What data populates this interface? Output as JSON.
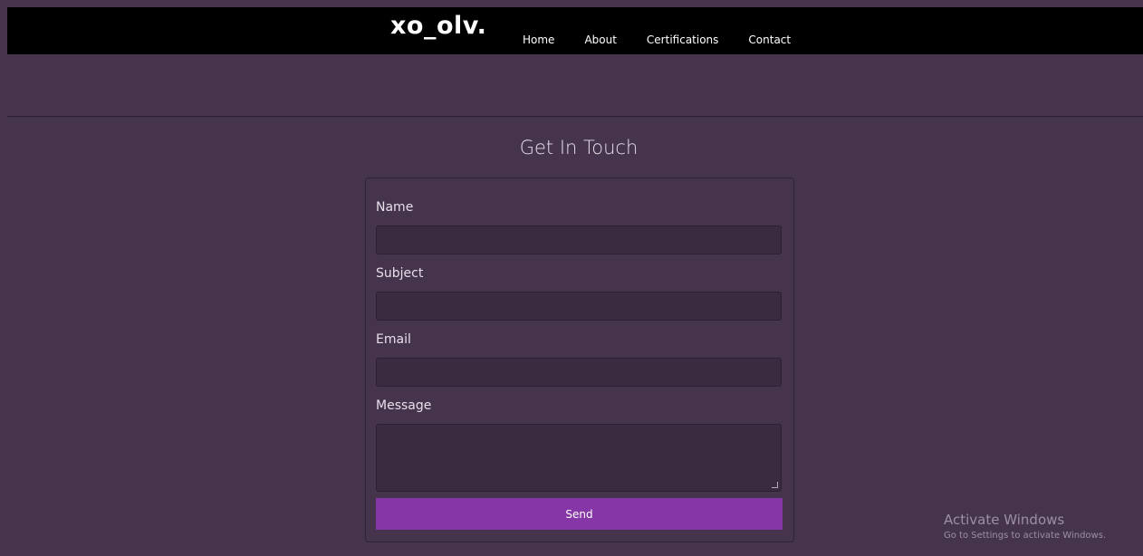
{
  "nav": {
    "brand": "xo_olv.",
    "links": [
      "Home",
      "About",
      "Certifications",
      "Contact"
    ]
  },
  "contact": {
    "title": "Get In Touch",
    "fields": {
      "name_label": "Name",
      "name_value": "",
      "subject_label": "Subject",
      "subject_value": "",
      "email_label": "Email",
      "email_value": "",
      "message_label": "Message",
      "message_value": ""
    },
    "send_label": "Send"
  },
  "watermark": {
    "title": "Activate Windows",
    "subtitle": "Go to Settings to activate Windows."
  },
  "colors": {
    "background": "#46344d",
    "navbar": "#000000",
    "input_bg": "#3a2b40",
    "accent": "#8636a6"
  }
}
